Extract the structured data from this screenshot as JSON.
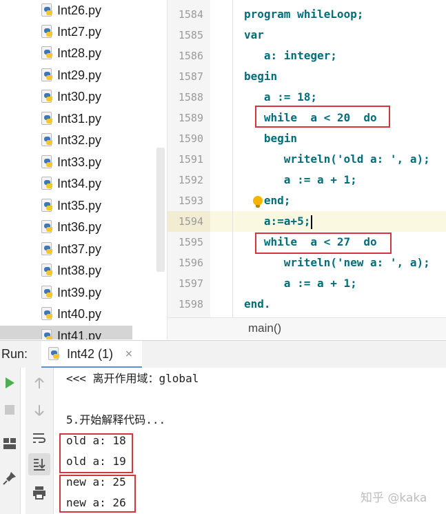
{
  "project_tree": {
    "files": [
      "Int26.py",
      "Int27.py",
      "Int28.py",
      "Int29.py",
      "Int30.py",
      "Int31.py",
      "Int32.py",
      "Int33.py",
      "Int34.py",
      "Int35.py",
      "Int36.py",
      "Int37.py",
      "Int38.py",
      "Int39.py",
      "Int40.py",
      "Int41.py"
    ],
    "selected": "Int41.py"
  },
  "editor": {
    "lines": [
      {
        "num": "1584",
        "text": "program whileLoop;"
      },
      {
        "num": "1585",
        "text": "var"
      },
      {
        "num": "1586",
        "text": "   a: integer;"
      },
      {
        "num": "1587",
        "text": "begin"
      },
      {
        "num": "1588",
        "text": "   a := 18;"
      },
      {
        "num": "1589",
        "text": "   while  a < 20  do"
      },
      {
        "num": "1590",
        "text": "   begin"
      },
      {
        "num": "1591",
        "text": "      writeln('old a: ', a);"
      },
      {
        "num": "1592",
        "text": "      a := a + 1;"
      },
      {
        "num": "1593",
        "text": "   end;"
      },
      {
        "num": "1594",
        "text": "   a:=a+5;"
      },
      {
        "num": "1595",
        "text": "   while  a < 27  do"
      },
      {
        "num": "1596",
        "text": "      writeln('new a: ', a);"
      },
      {
        "num": "1597",
        "text": "      a := a + 1;"
      },
      {
        "num": "1598",
        "text": "end."
      }
    ],
    "breadcrumb": "main()"
  },
  "run_panel": {
    "label": "Run:",
    "tab_label": "Int42 (1)",
    "tab_close": "×",
    "console": [
      "<<< 离开作用域：global",
      "",
      "5.开始解释代码...",
      "old a: 18",
      "old a: 19",
      "new a: 25",
      "new a: 26"
    ]
  },
  "watermark": "知乎 @kaka",
  "colors": {
    "keyword": "#006e7a",
    "highlight_box": "#d3363a",
    "current_line": "#fbf8e2",
    "tab_underline": "#5b8ed6"
  },
  "icons": [
    "python-file-icon",
    "run-icon",
    "stop-icon",
    "up-arrow-icon",
    "down-arrow-icon",
    "soft-wrap-icon",
    "scroll-to-end-icon",
    "print-icon",
    "pin-icon",
    "layout-icon",
    "lightbulb-icon"
  ]
}
